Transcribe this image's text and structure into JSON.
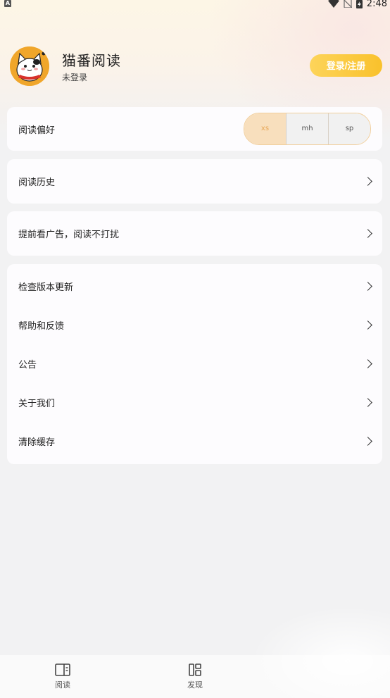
{
  "status_bar": {
    "indicator": "A",
    "time": "2:48"
  },
  "profile": {
    "app_name": "猫番阅读",
    "login_status": "未登录",
    "login_button": "登录/注册"
  },
  "reading_pref": {
    "label": "阅读偏好",
    "options": [
      "xs",
      "mh",
      "sp"
    ],
    "selected": "xs"
  },
  "history": {
    "label": "阅读历史"
  },
  "ads": {
    "label": "提前看广告，阅读不打扰"
  },
  "settings": {
    "items": [
      {
        "label": "检查版本更新"
      },
      {
        "label": "帮助和反馈"
      },
      {
        "label": "公告"
      },
      {
        "label": "关于我们"
      },
      {
        "label": "清除缓存"
      }
    ]
  },
  "bottom_nav": {
    "items": [
      {
        "label": "阅读",
        "icon": "book-icon"
      },
      {
        "label": "发现",
        "icon": "discover-icon"
      }
    ]
  },
  "colors": {
    "accent": "#f9c12c",
    "seg_active_bg": "#f8dfbd",
    "seg_active_text": "#e8a656"
  }
}
